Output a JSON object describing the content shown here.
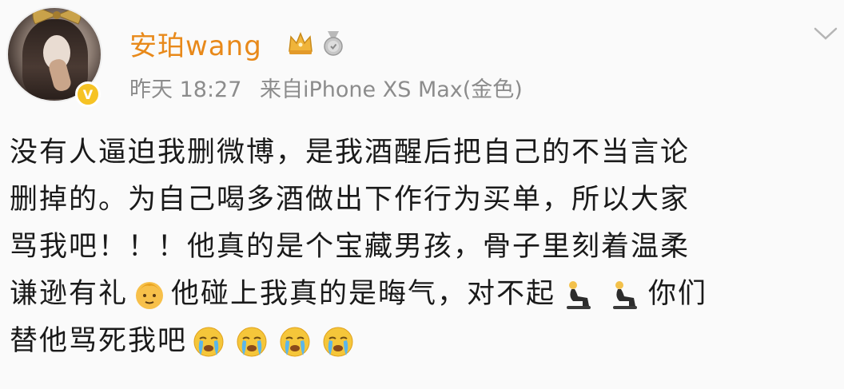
{
  "post": {
    "username": "安珀wang",
    "time": "昨天 18:27",
    "source": "来自iPhone XS Max(金色)",
    "lines": [
      {
        "segments": [
          {
            "text": "没有人逼迫我删微博，是我酒醒后把自己的不当言论"
          }
        ]
      },
      {
        "segments": [
          {
            "text": "删掉的。为自己喝多酒做出下作行为买单，所以大家"
          }
        ]
      },
      {
        "segments": [
          {
            "text": "骂我吧！！！他真的是个宝藏男孩，骨子里刻着温柔"
          }
        ]
      },
      {
        "segments": [
          {
            "text": "谦逊有礼"
          },
          {
            "emoji": "baby-emoji"
          },
          {
            "text": "他碰上我真的是晦气，对不起"
          },
          {
            "emoji": "kneeling-person-emoji"
          },
          {
            "emoji": "kneeling-person-emoji"
          },
          {
            "text": "你们"
          }
        ]
      },
      {
        "segments": [
          {
            "text": "替他骂死我吧"
          },
          {
            "emoji": "crying-face-emoji"
          },
          {
            "emoji": "crying-face-emoji"
          },
          {
            "emoji": "crying-face-emoji"
          },
          {
            "emoji": "crying-face-emoji"
          }
        ]
      }
    ]
  },
  "icons": {
    "verify": "verified-badge-icon",
    "crown": "crown-icon",
    "medal": "medal-icon",
    "menu": "chevron-down-icon"
  },
  "colors": {
    "username": "#e8891a",
    "meta": "#8c8c8c",
    "text": "#1a1a1a",
    "badge": "#f6c325"
  }
}
